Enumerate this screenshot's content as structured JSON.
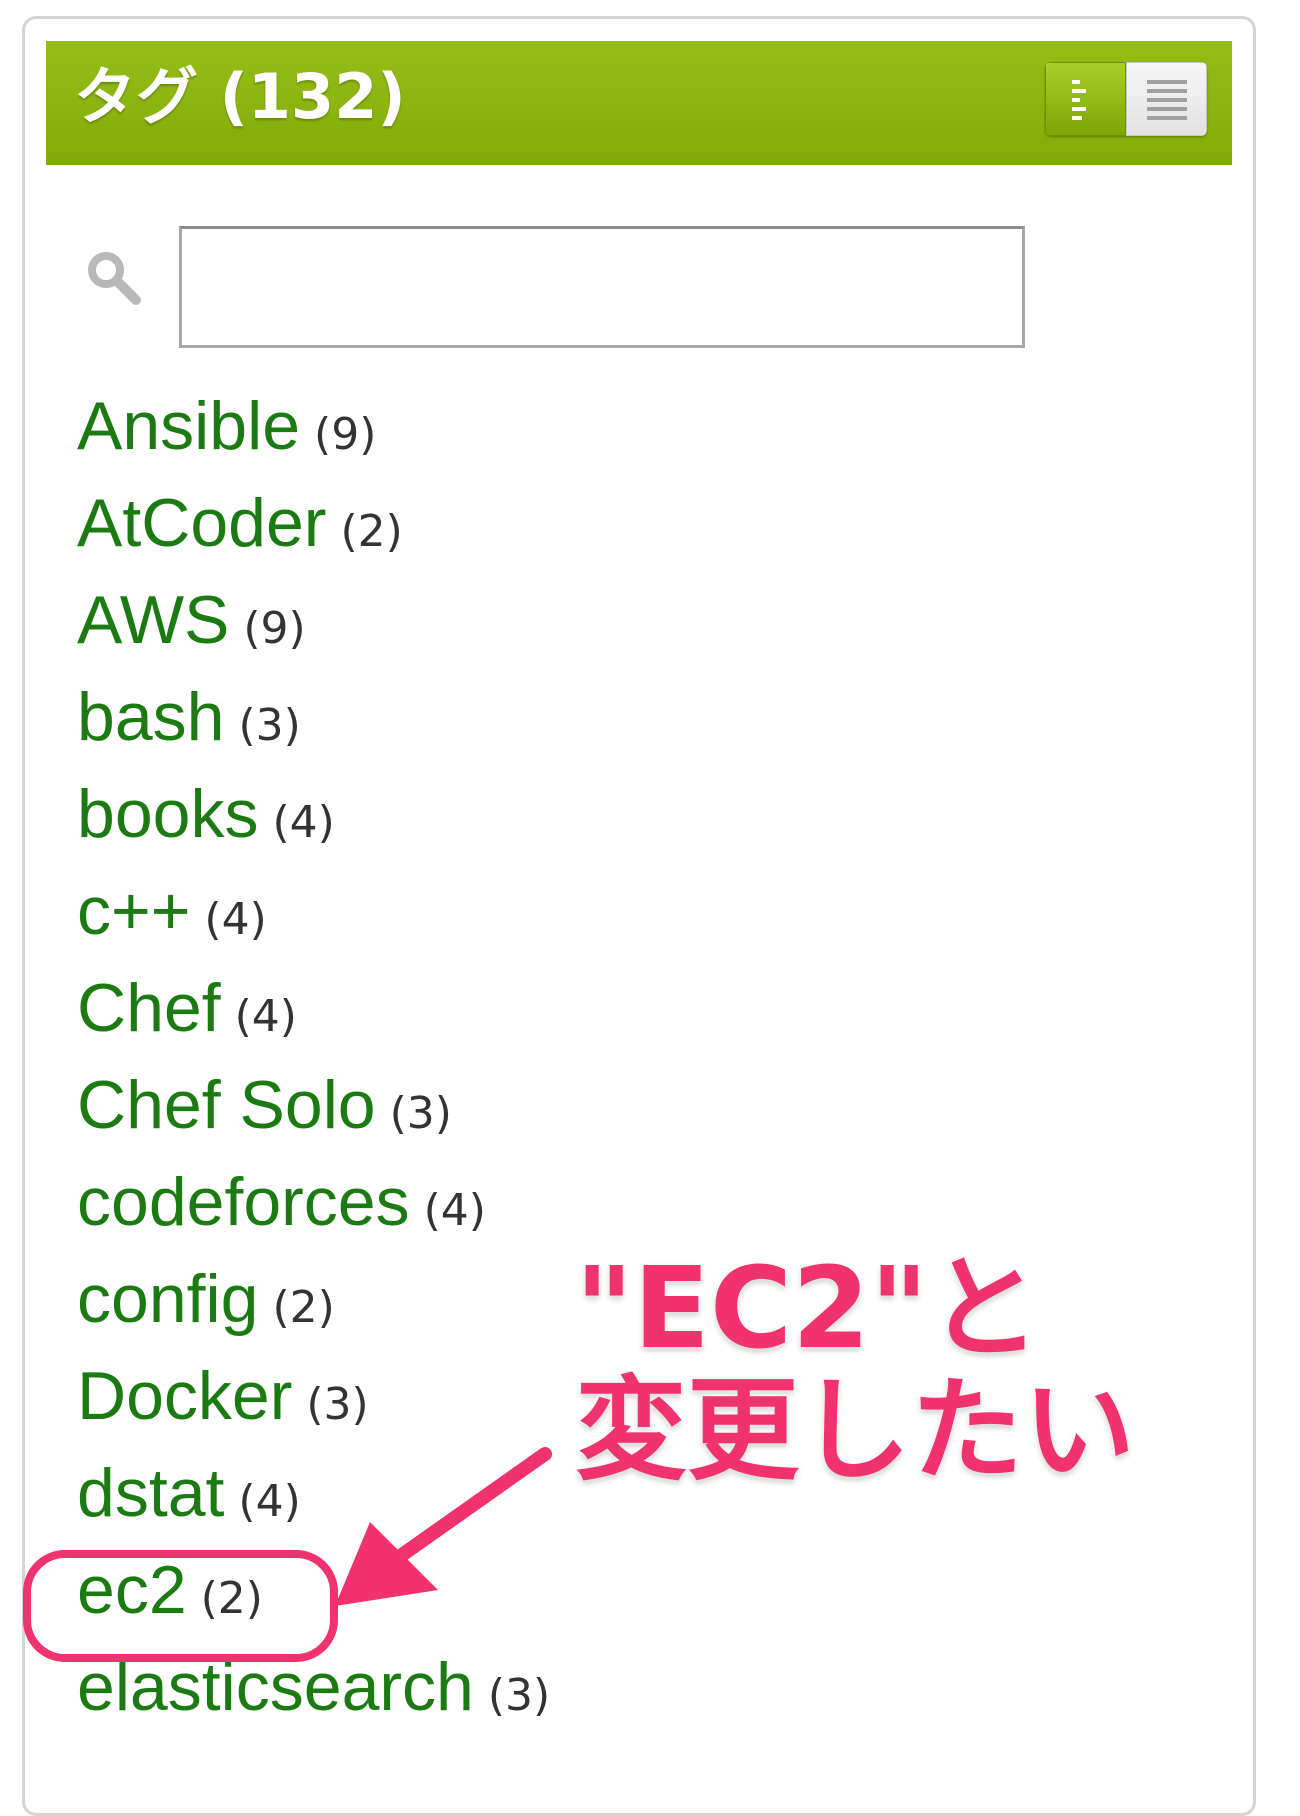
{
  "panel": {
    "title": "タグ (132)",
    "view_toggle": {
      "list_icon": "list-view-icon",
      "cloud_icon": "cloud-view-icon"
    }
  },
  "search": {
    "icon": "search-icon",
    "value": "",
    "placeholder": ""
  },
  "tags": [
    {
      "name": "Ansible",
      "count": "(9)"
    },
    {
      "name": "AtCoder",
      "count": "(2)"
    },
    {
      "name": "AWS",
      "count": "(9)"
    },
    {
      "name": "bash",
      "count": "(3)"
    },
    {
      "name": "books",
      "count": "(4)"
    },
    {
      "name": "c++",
      "count": "(4)"
    },
    {
      "name": "Chef",
      "count": "(4)"
    },
    {
      "name": "Chef Solo",
      "count": "(3)"
    },
    {
      "name": "codeforces",
      "count": "(4)"
    },
    {
      "name": "config",
      "count": "(2)"
    },
    {
      "name": "Docker",
      "count": "(3)"
    },
    {
      "name": "dstat",
      "count": "(4)"
    },
    {
      "name": "ec2",
      "count": "(2)"
    },
    {
      "name": "elasticsearch",
      "count": "(3)"
    }
  ],
  "annotation": {
    "line1": "\"EC2\"と",
    "line2": "変更したい"
  },
  "colors": {
    "header_green": "#8cb410",
    "tag_green": "#1b7a12",
    "annotation_pink": "#f0336e"
  }
}
